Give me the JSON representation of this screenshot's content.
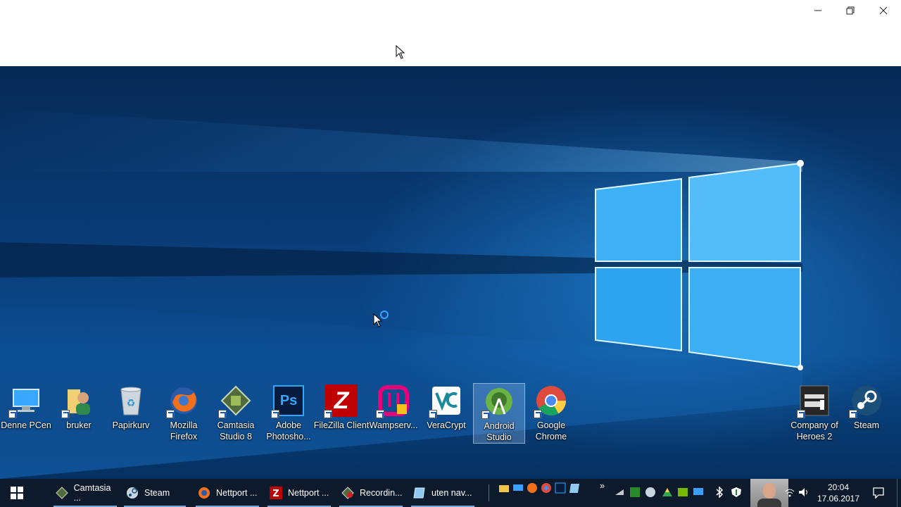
{
  "window": {
    "minimize_icon": "minimize-icon",
    "restore_icon": "restore-icon",
    "close_icon": "close-icon"
  },
  "desktop": {
    "icons": [
      {
        "label_lines": [
          "Denne PCen"
        ],
        "icon": "computer-icon"
      },
      {
        "label_lines": [
          "bruker"
        ],
        "icon": "user-folder-icon"
      },
      {
        "label_lines": [
          "Papirkurv"
        ],
        "icon": "recycle-bin-icon"
      },
      {
        "label_lines": [
          "Mozilla",
          "Firefox"
        ],
        "icon": "firefox-icon"
      },
      {
        "label_lines": [
          "Camtasia",
          "Studio 8"
        ],
        "icon": "camtasia-icon"
      },
      {
        "label_lines": [
          "Adobe",
          "Photosho..."
        ],
        "icon": "photoshop-icon",
        "glyph": "Ps"
      },
      {
        "label_lines": [
          "FileZilla Client"
        ],
        "icon": "filezilla-icon",
        "glyph": "Z"
      },
      {
        "label_lines": [
          "Wampserv..."
        ],
        "icon": "wampserver-icon"
      },
      {
        "label_lines": [
          "VeraCrypt"
        ],
        "icon": "veracrypt-icon"
      },
      {
        "label_lines": [
          "Android",
          "Studio"
        ],
        "icon": "android-studio-icon",
        "selected": true
      },
      {
        "label_lines": [
          "Google",
          "Chrome"
        ],
        "icon": "chrome-icon"
      },
      {
        "label_lines": [
          "Company of",
          "Heroes 2"
        ],
        "icon": "company-of-heroes-icon"
      },
      {
        "label_lines": [
          "Steam"
        ],
        "icon": "steam-icon"
      }
    ]
  },
  "taskbar": {
    "start_icon": "windows-start-icon",
    "items": [
      {
        "label": "Camtasia ...",
        "icon": "camtasia-icon"
      },
      {
        "label": "Steam",
        "icon": "steam-icon"
      },
      {
        "label": "Nettport ...",
        "icon": "firefox-icon"
      },
      {
        "label": "Nettport ...",
        "icon": "filezilla-icon"
      },
      {
        "label": "Recordin...",
        "icon": "recording-icon"
      },
      {
        "label": "uten nav...",
        "icon": "notepad-icon"
      }
    ],
    "overflow_glyph": "»",
    "clock": {
      "time": "20:04",
      "date": "17.06.2017"
    },
    "notification_icon": "action-center-icon"
  },
  "colors": {
    "taskbar_bg": "#0d1a2b",
    "taskbar_underline": "#7aa7d6",
    "desktop_accent": "#1e9ef2"
  }
}
